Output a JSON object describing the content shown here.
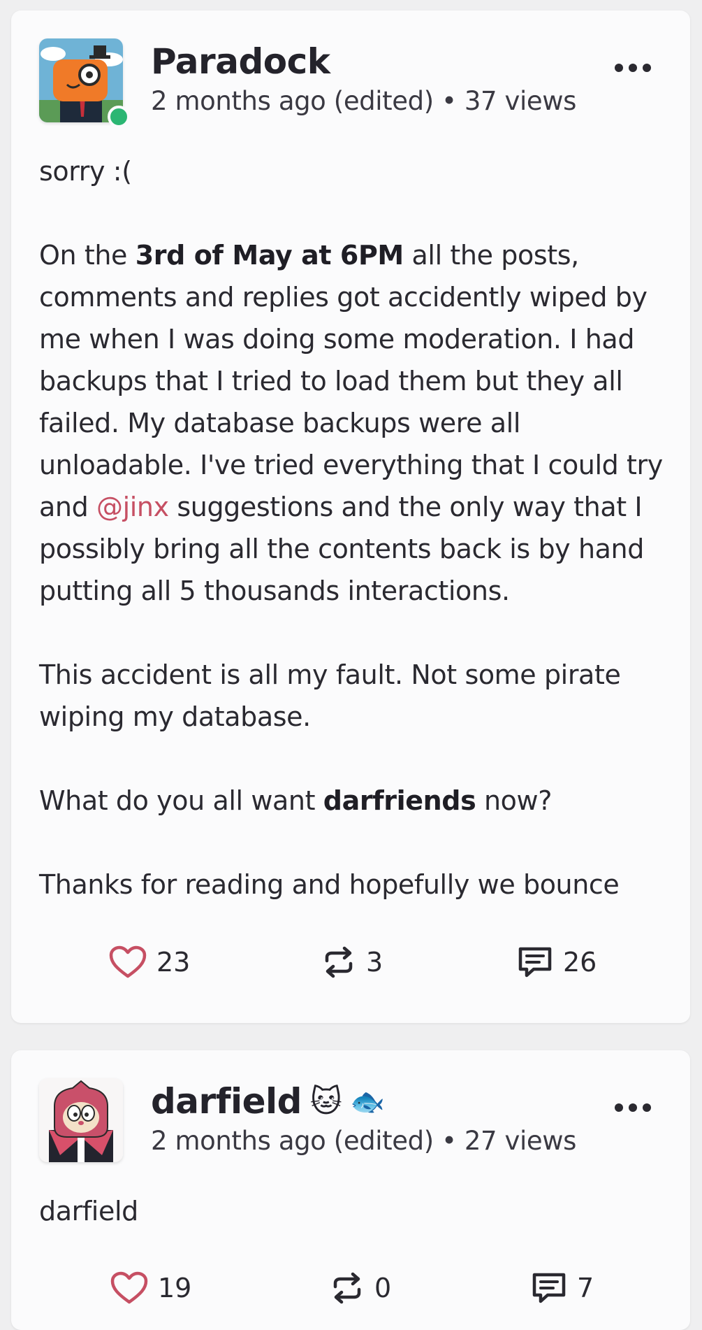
{
  "posts": [
    {
      "author": "Paradock",
      "meta": "2 months ago (edited) • 37 views",
      "online": true,
      "paragraphs": {
        "p1": "sorry :(",
        "p2a": "On the ",
        "p2b": "3rd of May at 6PM",
        "p2c": " all the posts, comments and replies got accidently wiped by me when I was doing some moderation. I had backups that I tried to load them but they all failed. My database backups were all unloadable. I've tried everything that I could try and ",
        "p2mention": "@jinx",
        "p2d": " suggestions and the only way that I possibly bring all the contents back is by hand putting all 5 thousands interactions.",
        "p3": "This accident is all my fault. Not some pirate wiping my database.",
        "p4a": "What do you all want ",
        "p4b": "darfriends",
        "p4c": " now?",
        "p5": "Thanks for reading and hopefully we bounce"
      },
      "likes": "23",
      "reposts": "3",
      "comments": "26"
    },
    {
      "author": "darfield",
      "author_emoji_1": "🐱",
      "author_emoji_2": "🐟",
      "meta": "2 months ago (edited) • 27 views",
      "body": "darfield",
      "likes": "19",
      "reposts": "0",
      "comments": "7"
    }
  ],
  "colors": {
    "like": "#c64f63",
    "mention": "#c64f63",
    "online": "#2bb673"
  },
  "icons": {
    "like": "heart-icon",
    "repost": "repost-icon",
    "comment": "comment-icon",
    "menu": "more-horizontal-icon"
  }
}
